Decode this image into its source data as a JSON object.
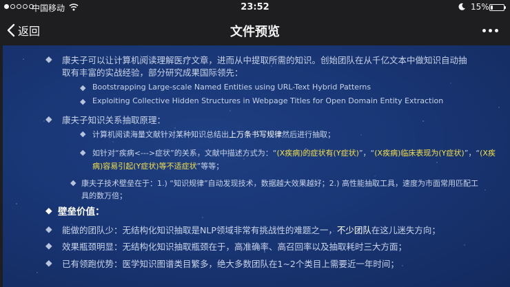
{
  "status_bar": {
    "carrier": "中国移动",
    "time": "23:52",
    "battery_percent": "15%",
    "battery_level": 0.15
  },
  "nav": {
    "back_label": "返回",
    "title": "文件预览"
  },
  "slide": {
    "p1_a": "康夫子可以让计算机阅读理解医疗文章，进而从中提取所需的知识。创始团队在从千亿文本中做知识自动抽",
    "p1_b": "取有丰富的实战经验，部分研究成果国际领先：",
    "paper1": "Bootstrapping Large-scale Named Entities using URL-Text Hybrid Patterns",
    "paper2": "Exploiting Collective Hidden Structures in Webpage Titles for Open Domain Entity Extraction",
    "p2": "康夫子知识关系抽取原理：",
    "s1_pre": "计算机阅读海量文献针对某种知识总结出",
    "s1_hl": "上万条书写规律",
    "s1_post": "然后进行抽取；",
    "s2_pre": "如针对“疾病<--->症状”的关系，文献中描述方式为：“",
    "s2_q1": "(X疾病)的症状有(Y症状)",
    "s2_sep1": "”，“",
    "s2_q2": "(X疾病)临床表现为(Y症状)",
    "s2_sep2": "”，“",
    "s2_q3a": "(X疾",
    "s2_q3b": "病)容易引起(Y症状)等不适症状",
    "s2_post": "”等等；",
    "s3_a": "康夫子技术壁垒在于：1.) “知识规律”自动发现技术，数据越大效果越好；2.) 高性能抽取工具，速度为市面常用匹配工",
    "s3_b": "具的数万倍；",
    "h_value": "壁垒价值：",
    "v1_pre": "能做的团队少：无结构化知识抽取是NLP领域非常有挑战性的难题之一，",
    "v1_hl": "不少团队",
    "v1_post": "在这儿迷失方向；",
    "v2": "效果瓶颈明显：无结构化知识抽取瓶颈在于，高准确率、高召回率以及抽取耗时三大方面；",
    "v3": "已有领跑优势：医学知识图谱类目繁多，绝大多数团队在1~2个类目上需要近一年时间；"
  }
}
